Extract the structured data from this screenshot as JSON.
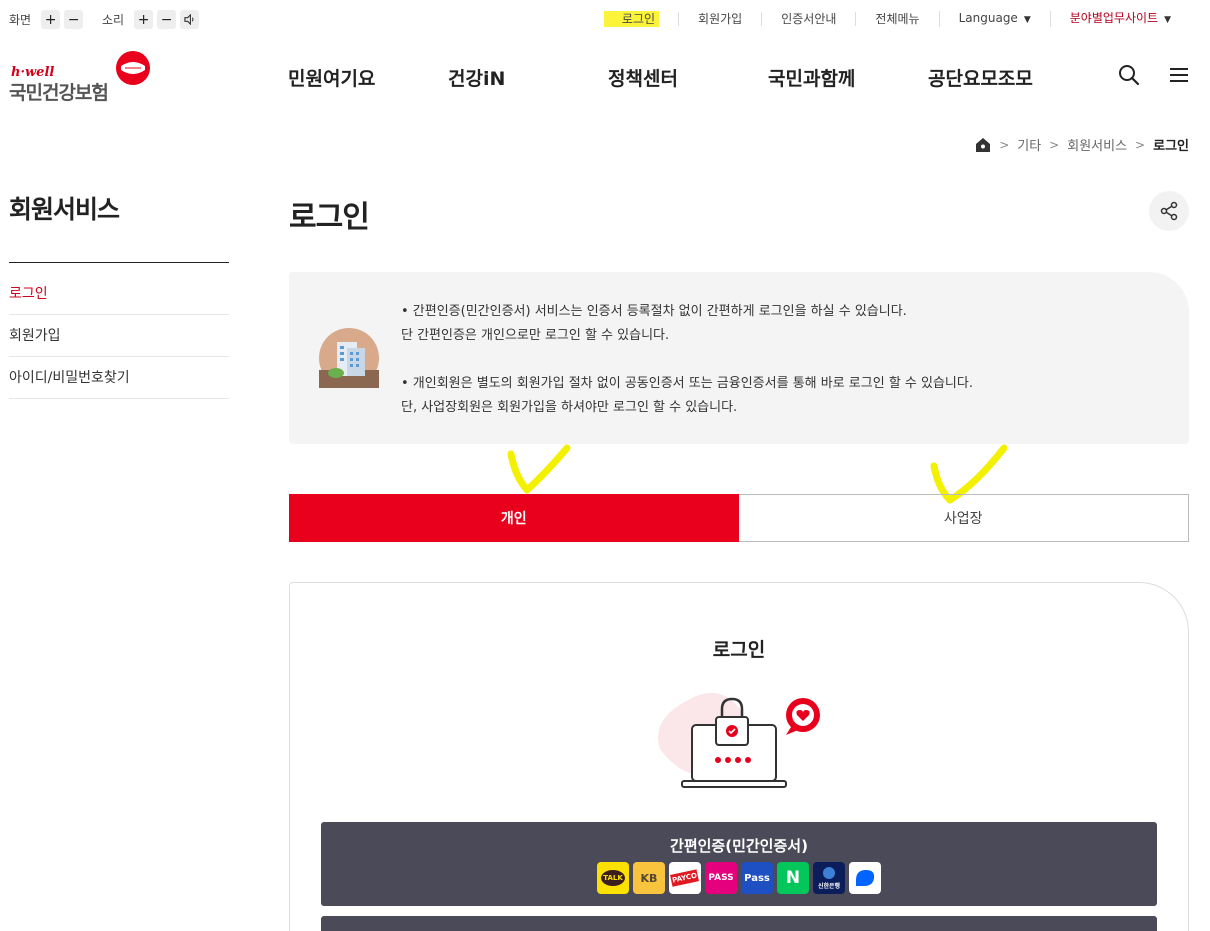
{
  "utility": {
    "screen_label": "화면",
    "sound_label": "소리",
    "plus": "+",
    "minus": "−"
  },
  "top_links": {
    "login": "로그인",
    "join": "회원가입",
    "cert": "인증서안내",
    "allmenu": "전체메뉴",
    "language": "Language",
    "business_site": "분야별업무사이트"
  },
  "logo": {
    "brand": "h·well",
    "name": "국민건강보험"
  },
  "gnb": [
    "민원여기요",
    "건강iN",
    "정책센터",
    "국민과함께",
    "공단요모조모"
  ],
  "breadcrumb": {
    "items": [
      "기타",
      "회원서비스"
    ],
    "current": "로그인"
  },
  "sidebar": {
    "title": "회원서비스",
    "items": [
      {
        "label": "로그인",
        "active": true
      },
      {
        "label": "회원가입",
        "active": false
      },
      {
        "label": "아이디/비밀번호찾기",
        "active": false
      }
    ]
  },
  "page": {
    "title": "로그인"
  },
  "info": {
    "line1": "•  간편인증(민간인증서) 서비스는 인증서 등록절차 없이 간편하게 로그인을 하실 수 있습니다.",
    "line2": "단 간편인증은 개인으로만 로그인 할 수 있습니다.",
    "line3": "•  개인회원은 별도의 회원가입 절차 없이 공동인증서 또는 금융인증서를 통해 바로 로그인 할 수 있습니다.",
    "line4": "단, 사업장회원은 회원가입을 하셔야만 로그인 할 수 있습니다."
  },
  "tabs": {
    "personal": "개인",
    "business": "사업장"
  },
  "login": {
    "title": "로그인",
    "simple_auth_label": "간편인증(민간인증서)",
    "providers": [
      {
        "name": "kakao",
        "text": "TALK"
      },
      {
        "name": "kb",
        "text": "KB"
      },
      {
        "name": "payco",
        "text": "PAYCO"
      },
      {
        "name": "pass",
        "text": "PASS"
      },
      {
        "name": "samsung-pass",
        "text": "Pass"
      },
      {
        "name": "naver",
        "text": "N"
      },
      {
        "name": "shinhan",
        "text": "신한은행"
      },
      {
        "name": "toss",
        "text": ""
      }
    ]
  },
  "colors": {
    "accent": "#e8001c",
    "brand_red": "#d0021b",
    "button_dark": "#4b4a59",
    "highlight_yellow": "#fbf43a"
  }
}
